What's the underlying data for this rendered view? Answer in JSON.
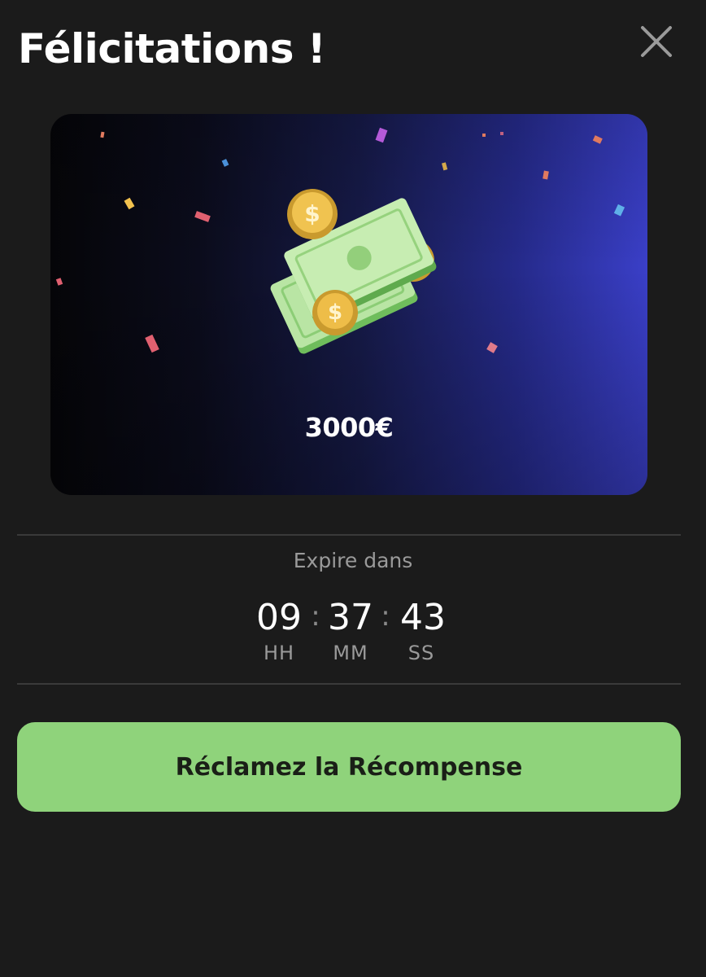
{
  "dialog": {
    "title": "Félicitations !",
    "close_icon": "close-icon"
  },
  "reward": {
    "amount": "3000€",
    "illustration": "money-bills-coins-icon",
    "coin_symbol": "$"
  },
  "countdown": {
    "label": "Expire dans",
    "hours": "09",
    "minutes": "37",
    "seconds": "43",
    "separator": ":",
    "hours_unit": "HH",
    "minutes_unit": "MM",
    "seconds_unit": "SS"
  },
  "actions": {
    "claim_label": "Réclamez la Récompense"
  },
  "colors": {
    "background": "#1b1b1b",
    "button": "#8fd37b",
    "banner_gradient_end": "#3a3fc8"
  }
}
